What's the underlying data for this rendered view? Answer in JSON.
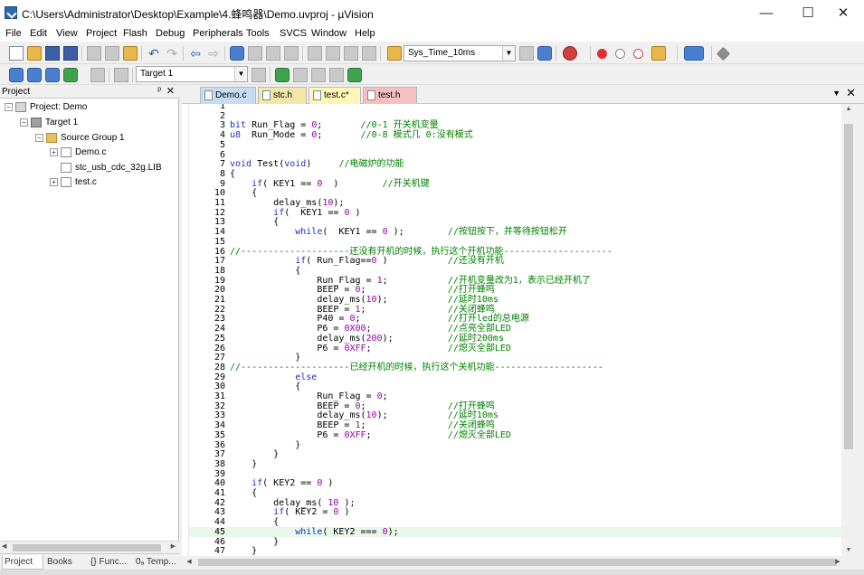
{
  "window": {
    "title": "C:\\Users\\Administrator\\Desktop\\Example\\4.蜂鸣器\\Demo.uvproj - µVision",
    "minimize": "—",
    "maximize": "☐",
    "close": "✕"
  },
  "menu": [
    "File",
    "Edit",
    "View",
    "Project",
    "Flash",
    "Debug",
    "Peripherals",
    "Tools",
    "SVCS",
    "Window",
    "Help"
  ],
  "toolbar": {
    "function_combo": "Sys_Time_10ms",
    "target_combo": "Target 1"
  },
  "project_panel": {
    "title": "Project",
    "pin": "ᵖ",
    "close": "✕",
    "tree": {
      "root": "Project: Demo",
      "target": "Target 1",
      "group": "Source Group 1",
      "files": [
        "Demo.c",
        "stc_usb_cdc_32g.LIB",
        "test.c"
      ]
    },
    "tabs": [
      "Project",
      "Books",
      "{} Func...",
      "0ₐ Temp..."
    ]
  },
  "editor_tabs": [
    "Demo.c",
    "stc.h",
    "test.c*",
    "test.h"
  ],
  "code_lines": [
    {
      "n": "1",
      "text": ""
    },
    {
      "n": "2",
      "text": ""
    },
    {
      "n": "3",
      "text": "bit Run_Flag = 0;       //0-1 开关机变量"
    },
    {
      "n": "4",
      "text": "u8  Run_Mode = 0;       //0-8 模式几 0:没有模式"
    },
    {
      "n": "5",
      "text": ""
    },
    {
      "n": "6",
      "text": ""
    },
    {
      "n": "7",
      "text": "void Test(void)     //电磁炉的功能"
    },
    {
      "n": "8",
      "text": "{"
    },
    {
      "n": "9",
      "text": "    if( KEY1 == 0  )        //开关机键"
    },
    {
      "n": "10",
      "text": "    {"
    },
    {
      "n": "11",
      "text": "        delay_ms(10);"
    },
    {
      "n": "12",
      "text": "        if(  KEY1 == 0 )"
    },
    {
      "n": "13",
      "text": "        {"
    },
    {
      "n": "14",
      "text": "            while(  KEY1 == 0 );        //按钮按下，并等待按钮松开"
    },
    {
      "n": "15",
      "text": ""
    },
    {
      "n": "16",
      "text": "//--------------------还没有开机的时候，执行这个开机功能--------------------"
    },
    {
      "n": "17",
      "text": "            if( Run_Flag==0 )           //还没有开机"
    },
    {
      "n": "18",
      "text": "            {"
    },
    {
      "n": "19",
      "text": "                Run_Flag = 1;           //开机变量改为1，表示已经开机了"
    },
    {
      "n": "20",
      "text": "                BEEP = 0;               //打开蜂鸣"
    },
    {
      "n": "21",
      "text": "                delay_ms(10);           //延时10ms"
    },
    {
      "n": "22",
      "text": "                BEEP = 1;               //关闭蜂鸣"
    },
    {
      "n": "23",
      "text": "                P40 = 0;                //打开led的总电源"
    },
    {
      "n": "24",
      "text": "                P6 = 0X00;              //点亮全部LED"
    },
    {
      "n": "25",
      "text": "                delay_ms(200);          //延时200ms"
    },
    {
      "n": "26",
      "text": "                P6 = 0XFF;              //熄灭全部LED"
    },
    {
      "n": "27",
      "text": "            }"
    },
    {
      "n": "28",
      "text": "//--------------------已经开机的时候，执行这个关机功能--------------------"
    },
    {
      "n": "29",
      "text": "            else"
    },
    {
      "n": "30",
      "text": "            {"
    },
    {
      "n": "31",
      "text": "                Run_Flag = 0;"
    },
    {
      "n": "32",
      "text": "                BEEP = 0;               //打开蜂鸣"
    },
    {
      "n": "33",
      "text": "                delay_ms(10);           //延时10ms"
    },
    {
      "n": "34",
      "text": "                BEEP = 1;               //关闭蜂鸣"
    },
    {
      "n": "35",
      "text": "                P6 = 0XFF;              //熄灭全部LED"
    },
    {
      "n": "36",
      "text": "            }"
    },
    {
      "n": "37",
      "text": "        }"
    },
    {
      "n": "38",
      "text": "    }"
    },
    {
      "n": "39",
      "text": ""
    },
    {
      "n": "40",
      "text": "    if( KEY2 == 0 )"
    },
    {
      "n": "41",
      "text": "    {"
    },
    {
      "n": "42",
      "text": "        delay_ms( 10 );"
    },
    {
      "n": "43",
      "text": "        if( KEY2 = 0 )"
    },
    {
      "n": "44",
      "text": "        {"
    },
    {
      "n": "45",
      "text": "            while( KEY2 === 0);"
    },
    {
      "n": "46",
      "text": "        }"
    },
    {
      "n": "47",
      "text": "    }"
    }
  ],
  "current_line": "45",
  "colors": {
    "keyword": "#1c2ec9",
    "comment": "#008000",
    "number": "#9a00a8",
    "current_line_bg": "#e8f7e8"
  }
}
